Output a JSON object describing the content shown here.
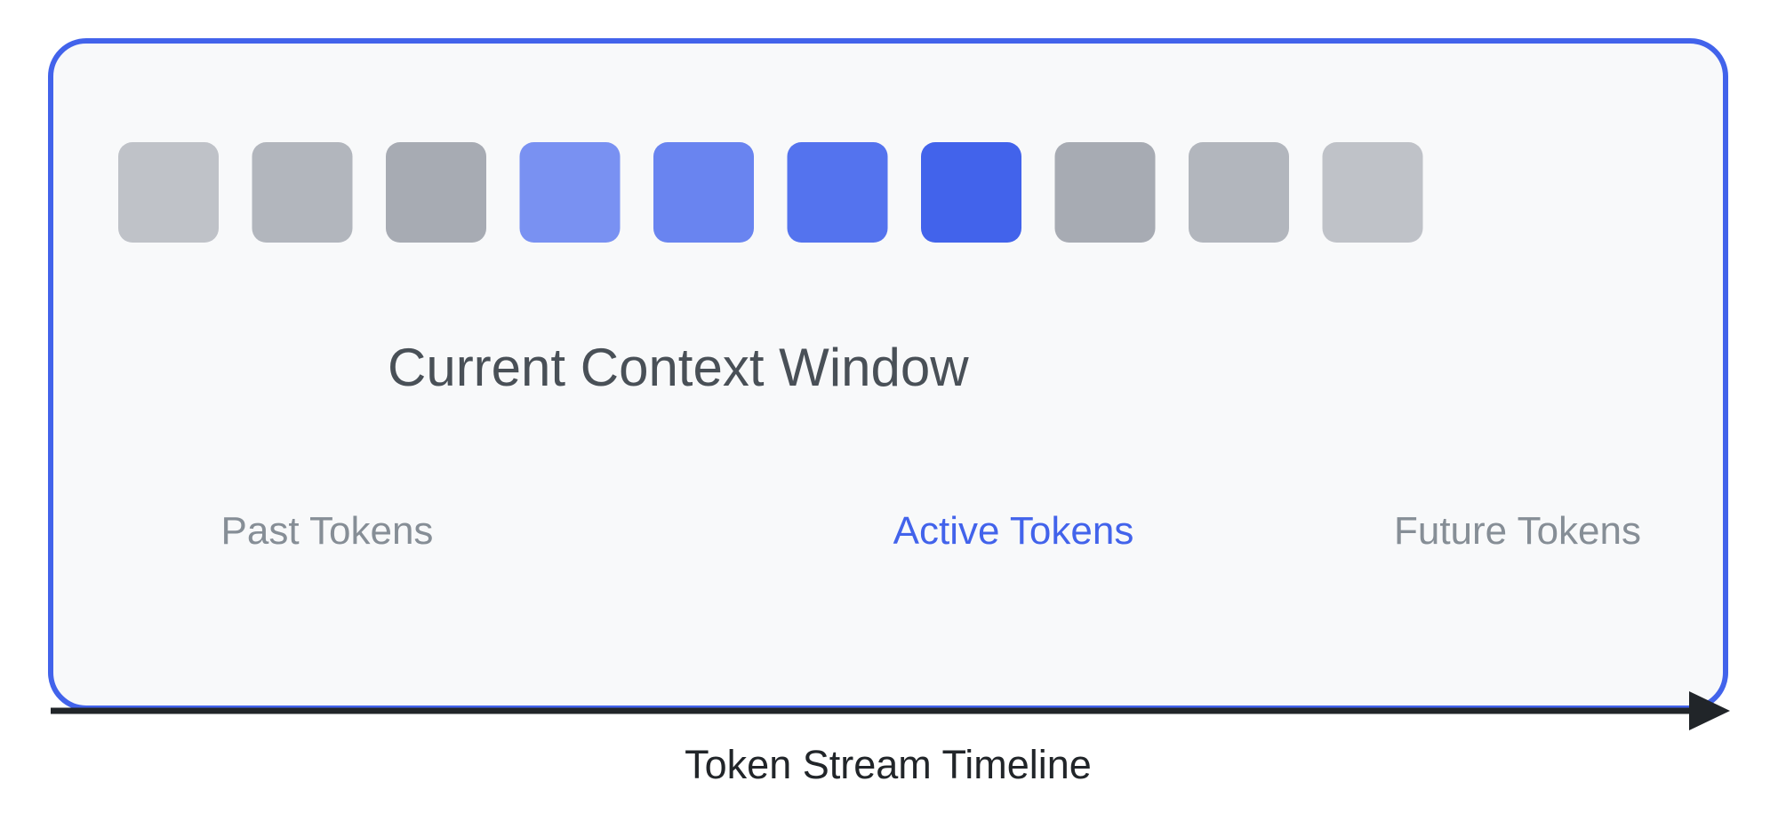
{
  "title": "Current Context Window",
  "axis_label": "Token Stream Timeline",
  "regions": {
    "past": {
      "label": "Past Tokens",
      "color": "#868e96"
    },
    "active": {
      "label": "Active Tokens",
      "color": "#4263eb"
    },
    "future": {
      "label": "Future Tokens",
      "color": "#868e96"
    }
  },
  "colors": {
    "frame_stroke": "#4263eb",
    "frame_fill": "#f8f9fa",
    "axis": "#212529",
    "title_text": "#495057",
    "axis_label_text": "#212529"
  },
  "tokens": [
    {
      "group": "past",
      "color": "#bfc2c8"
    },
    {
      "group": "past",
      "color": "#b2b6bd"
    },
    {
      "group": "past",
      "color": "#a7abb3"
    },
    {
      "group": "active",
      "color": "#7991f2"
    },
    {
      "group": "active",
      "color": "#6984f0"
    },
    {
      "group": "active",
      "color": "#5473ee"
    },
    {
      "group": "active",
      "color": "#4263eb"
    },
    {
      "group": "future",
      "color": "#a7abb3"
    },
    {
      "group": "future",
      "color": "#b2b6bd"
    },
    {
      "group": "future",
      "color": "#bfc2c8"
    }
  ]
}
